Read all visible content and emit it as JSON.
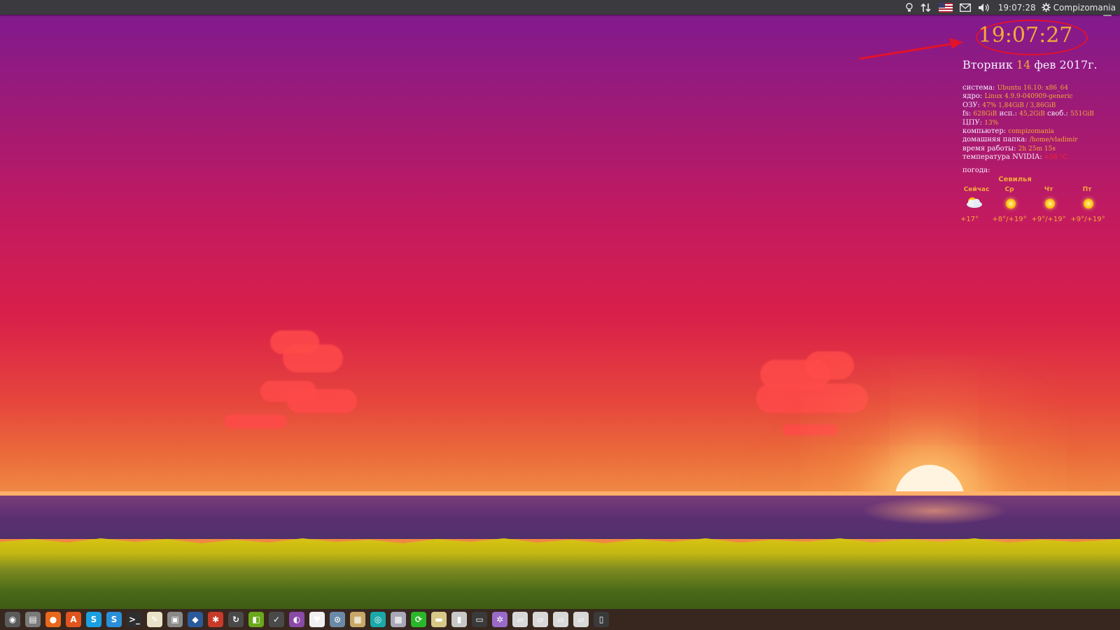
{
  "top_panel": {
    "clock": "19:07:28",
    "user": "Compizomania",
    "icons": [
      "bulb-icon",
      "network-arrows-icon",
      "us-flag-icon",
      "mail-icon",
      "volume-icon",
      "gear-icon"
    ]
  },
  "conky": {
    "time": "19:07:27",
    "date_day": "Вторник",
    "date_num": "14",
    "date_rest": "фев 2017г.",
    "system": {
      "label": "система:",
      "value": "Ubuntu 16.10: x86_64"
    },
    "kernel": {
      "label": "ядро:",
      "value": "Linux 4.9.9-040909-generic"
    },
    "ram": {
      "label": "ОЗУ:",
      "value": "47% 1,84GiB / 3,86GiB"
    },
    "fs": {
      "label": "fs:",
      "size": "628GiB",
      "used_label": "исп.:",
      "used": "45,2GiB",
      "free_label": "своб.:",
      "free": "551GiB"
    },
    "cpu": {
      "label": "ЦПУ:",
      "value": "13%"
    },
    "computer": {
      "label": "компьютер:",
      "value": "compizomania"
    },
    "home": {
      "label": "домашняя папка:",
      "value": "/home/vladimir"
    },
    "uptime": {
      "label": "время работы:",
      "value": "2h 25m 15s"
    },
    "nvidia": {
      "label": "температура NVIDIA:",
      "value": "+56 °C"
    },
    "weather": {
      "label": "погода:",
      "city": "Севилья",
      "days": [
        {
          "name": "Сейчас",
          "temp": "+17°",
          "icon": "partly-cloudy-icon"
        },
        {
          "name": "Ср",
          "temp": "+8°/+19°",
          "icon": "sun-icon"
        },
        {
          "name": "Чт",
          "temp": "+9°/+19°",
          "icon": "sun-icon"
        },
        {
          "name": "Пт",
          "temp": "+9°/+19°",
          "icon": "sun-icon"
        }
      ]
    }
  },
  "dock": {
    "icons": [
      {
        "name": "dash-icon",
        "glyph": "◉",
        "color": "#5a5a5a"
      },
      {
        "name": "files-icon",
        "glyph": "▤",
        "color": "#7a7a7a"
      },
      {
        "name": "firefox-icon",
        "glyph": "●",
        "color": "#e8681c"
      },
      {
        "name": "software-center-icon",
        "glyph": "A",
        "color": "#e0551e"
      },
      {
        "name": "skype-icon",
        "glyph": "S",
        "color": "#1a9fe0"
      },
      {
        "name": "skype-alt-icon",
        "glyph": "S",
        "color": "#2a8fd8"
      },
      {
        "name": "terminal-icon",
        "glyph": ">_",
        "color": "#2e2e2e"
      },
      {
        "name": "text-editor-icon",
        "glyph": "✎",
        "color": "#e8e2c8"
      },
      {
        "name": "screenshot-icon",
        "glyph": "▣",
        "color": "#8a8a8a"
      },
      {
        "name": "synaptic-icon",
        "glyph": "◆",
        "color": "#2a5a9a"
      },
      {
        "name": "settings-icon",
        "glyph": "✱",
        "color": "#c83a2a"
      },
      {
        "name": "updater-icon",
        "glyph": "↻",
        "color": "#4a4a4a"
      },
      {
        "name": "nvidia-icon",
        "glyph": "◧",
        "color": "#6aa81c"
      },
      {
        "name": "tasks-icon",
        "glyph": "✓",
        "color": "#4a4a4a"
      },
      {
        "name": "picture-viewer-icon",
        "glyph": "◐",
        "color": "#8a4aa8"
      },
      {
        "name": "cards-icon",
        "glyph": "♥",
        "color": "#f0f0f0"
      },
      {
        "name": "disks-icon",
        "glyph": "⊙",
        "color": "#6a8aa8"
      },
      {
        "name": "archive-icon",
        "glyph": "▦",
        "color": "#c8a868"
      },
      {
        "name": "browser-icon",
        "glyph": "◎",
        "color": "#1aa8a8"
      },
      {
        "name": "photo-icon",
        "glyph": "▩",
        "color": "#a8a8b8"
      },
      {
        "name": "sync-icon",
        "glyph": "⟳",
        "color": "#2ab82a"
      },
      {
        "name": "folder-icon",
        "glyph": "▬",
        "color": "#d8c888"
      },
      {
        "name": "media-icon",
        "glyph": "▮",
        "color": "#c8c8c8"
      },
      {
        "name": "drive-icon",
        "glyph": "▭",
        "color": "#3a3a3a"
      },
      {
        "name": "tweak-icon",
        "glyph": "✲",
        "color": "#9a6ac8"
      },
      {
        "name": "disk-a-icon",
        "glyph": "▱",
        "color": "#d8d8d8"
      },
      {
        "name": "disk-b-icon",
        "glyph": "▱",
        "color": "#d8d8d8"
      },
      {
        "name": "disk-c-icon",
        "glyph": "▱",
        "color": "#d8d8d8"
      },
      {
        "name": "disk-d-icon",
        "glyph": "▱",
        "color": "#d8d8d8"
      },
      {
        "name": "phone-icon",
        "glyph": "▯",
        "color": "#3a3a3a"
      }
    ]
  },
  "colors": {
    "accent": "#f3a93a",
    "annotation": "#e2122b"
  }
}
